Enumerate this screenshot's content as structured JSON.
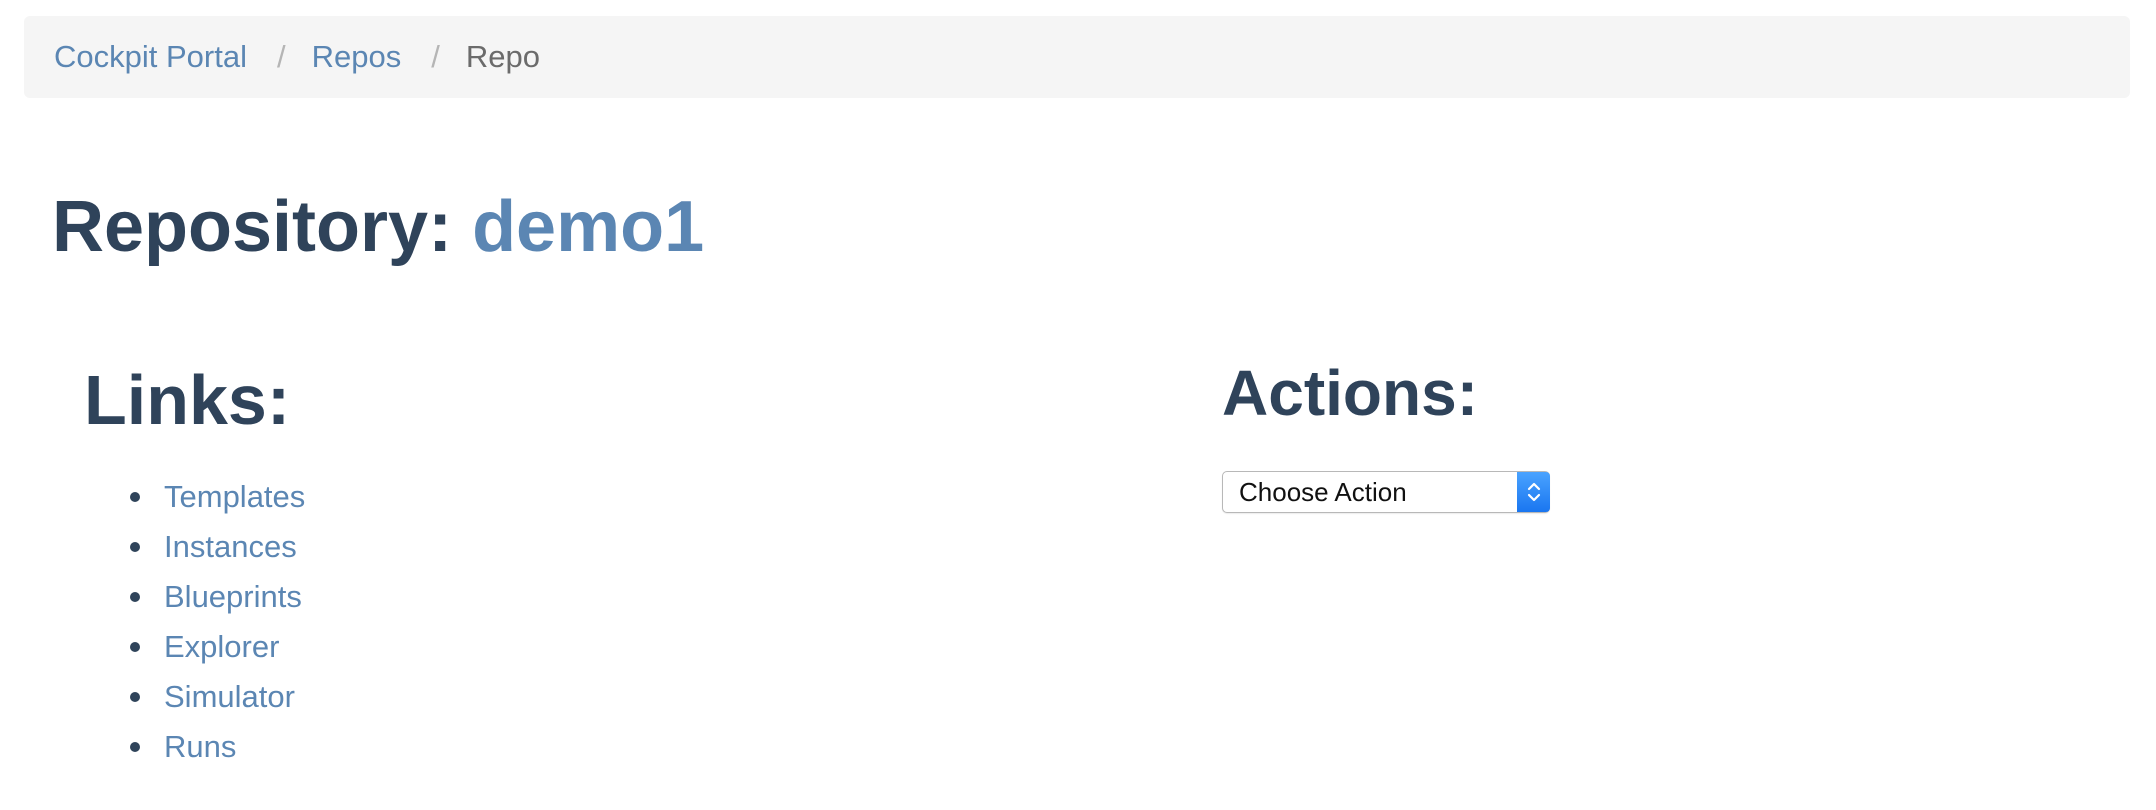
{
  "breadcrumb": {
    "items": [
      {
        "label": "Cockpit Portal"
      },
      {
        "label": "Repos"
      }
    ],
    "separator": "/",
    "current": "Repo"
  },
  "title": {
    "prefix": "Repository:",
    "repo_name": "demo1"
  },
  "links": {
    "heading": "Links:",
    "items": [
      {
        "label": "Templates"
      },
      {
        "label": "Instances"
      },
      {
        "label": "Blueprints"
      },
      {
        "label": "Explorer"
      },
      {
        "label": "Simulator"
      },
      {
        "label": "Runs"
      }
    ]
  },
  "actions": {
    "heading": "Actions:",
    "select_value": "Choose Action",
    "select_icon": "updown-chevron-icon"
  },
  "colors": {
    "link": "#5b86b3",
    "heading": "#2f435a",
    "breadcrumb_bg": "#f5f5f5",
    "select_accent": "#1a76f0"
  }
}
